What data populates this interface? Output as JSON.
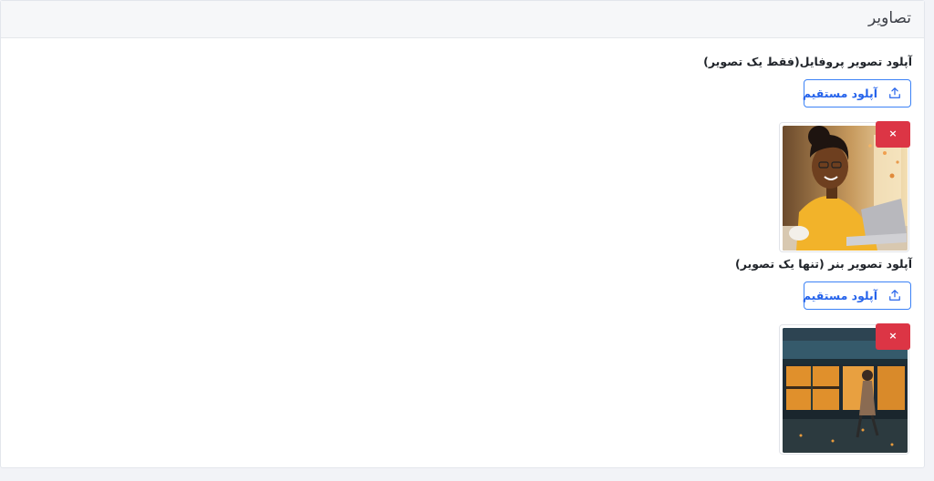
{
  "panel": {
    "title": "تصاویر"
  },
  "profile": {
    "label": "آپلود تصویر پروفایل(فقط یک تصویر)",
    "upload_label": "آپلود مستقیم",
    "remove_label": "×",
    "image_icon": "woman-with-laptop-photo"
  },
  "banner": {
    "label": "آپلود تصویر بنر (تنها یک تصویر)",
    "upload_label": "آپلود مستقیم",
    "remove_label": "×",
    "image_icon": "storefront-night-photo"
  },
  "colors": {
    "accent": "#2563eb",
    "danger": "#dc3545",
    "header_bg": "#f6f7f9"
  }
}
